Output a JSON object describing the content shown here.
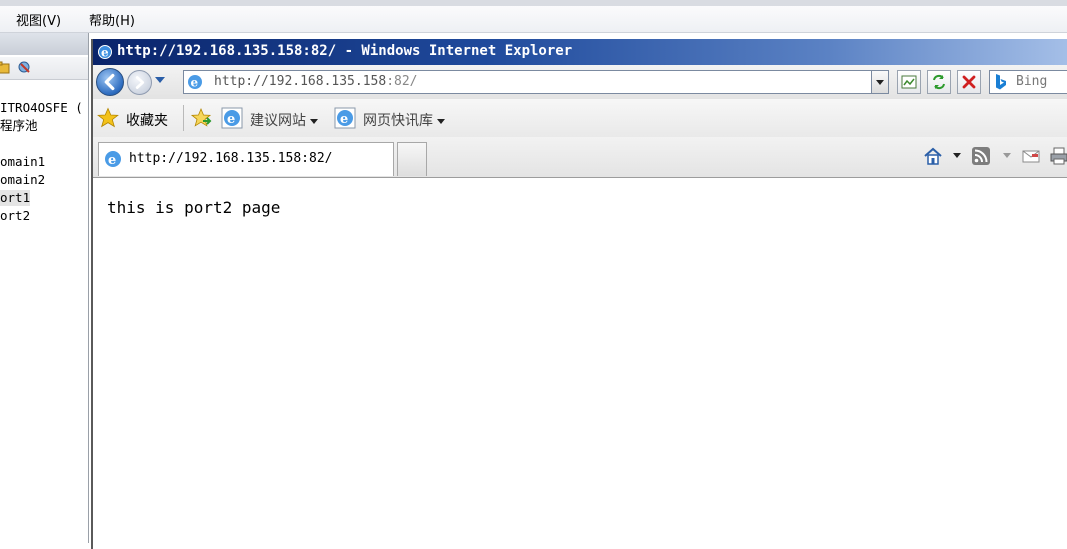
{
  "background_window": {
    "menu": [
      {
        "label": "视图(V)"
      },
      {
        "label": "帮助(H)"
      }
    ],
    "tree": {
      "items": [
        {
          "label": "ITRO4OSFE ("
        },
        {
          "label": "程序池"
        },
        {
          "label": "omain1"
        },
        {
          "label": "omain2"
        },
        {
          "label": "ort1"
        },
        {
          "label": "ort2"
        }
      ]
    }
  },
  "browser": {
    "title": "http://192.168.135.158:82/ - Windows Internet Explorer",
    "address": {
      "value_host": "http://192.168.135.158",
      "value_port": ":82/"
    },
    "search": {
      "provider": "Bing"
    },
    "favorites_bar": {
      "favorites_label": "收藏夹",
      "suggested_sites_label": "建议网站",
      "web_slice_label": "网页快讯库"
    },
    "tab": {
      "label": "http://192.168.135.158:82/"
    },
    "page": {
      "text": "this is port2 page"
    },
    "colors": {
      "title_start": "#0a246a",
      "title_end": "#a6c0e8"
    }
  }
}
